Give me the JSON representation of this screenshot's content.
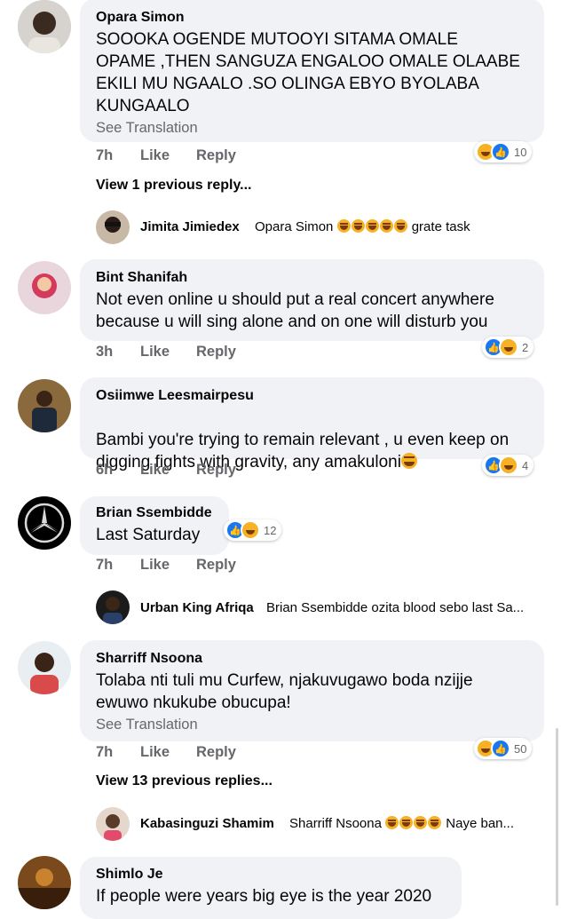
{
  "labels": {
    "like": "Like",
    "reply": "Reply",
    "see_translation": "See Translation"
  },
  "comments": [
    {
      "name": "Opara Simon",
      "text": "SOOOKA OGENDE MUTOOYI SITAMA OMALE\nOPAME ,THEN SANGUZA ENGALOO OMALE OLAABE\nEKILI MU NGAALO .SO OLINGA EBYO BYOLABA\nKUNGAALO",
      "time": "7h",
      "reactions": "10",
      "view_replies": "View 1 previous reply...",
      "reply": {
        "name": "Jimita Jimiedex",
        "text_prefix": "Opara Simon",
        "text_suffix": "grate task"
      }
    },
    {
      "name": "Bint Shanifah",
      "text": "Not even online u should put a real concert anywhere\nbecause u will sing alone and on one will disturb you",
      "time": "3h",
      "reactions": "2"
    },
    {
      "name": "Osiimwe Leesmairpesu",
      "text": "Bambi you're trying to remain relevant , u even keep on\ndigging fights with gravity, any amakuloni",
      "time": "6h",
      "reactions": "4"
    },
    {
      "name": "Brian Ssembidde",
      "text": "Last Saturday",
      "time": "7h",
      "reactions": "12",
      "reply": {
        "name": "Urban King Afriqa",
        "text": "Brian Ssembidde ozita blood sebo last Sa..."
      }
    },
    {
      "name": "Sharriff Nsoona",
      "text": "Tolaba nti tuli mu Curfew, njakuvugawo boda nzijje\newuwo nkukube obucupa!",
      "time": "7h",
      "reactions": "50",
      "view_replies": "View 13 previous replies...",
      "reply": {
        "name": "Kabasinguzi Shamim",
        "text_prefix": "Sharriff Nsoona",
        "text_suffix": "Naye ban..."
      }
    },
    {
      "name": "Shimlo Je",
      "text": "If people were years big eye is the year 2020"
    }
  ],
  "colors": {
    "like_blue": "#1877f2",
    "haha_yellow": "#f7b125",
    "bubble": "#f0f2f5",
    "meta_gray": "#65676b"
  }
}
